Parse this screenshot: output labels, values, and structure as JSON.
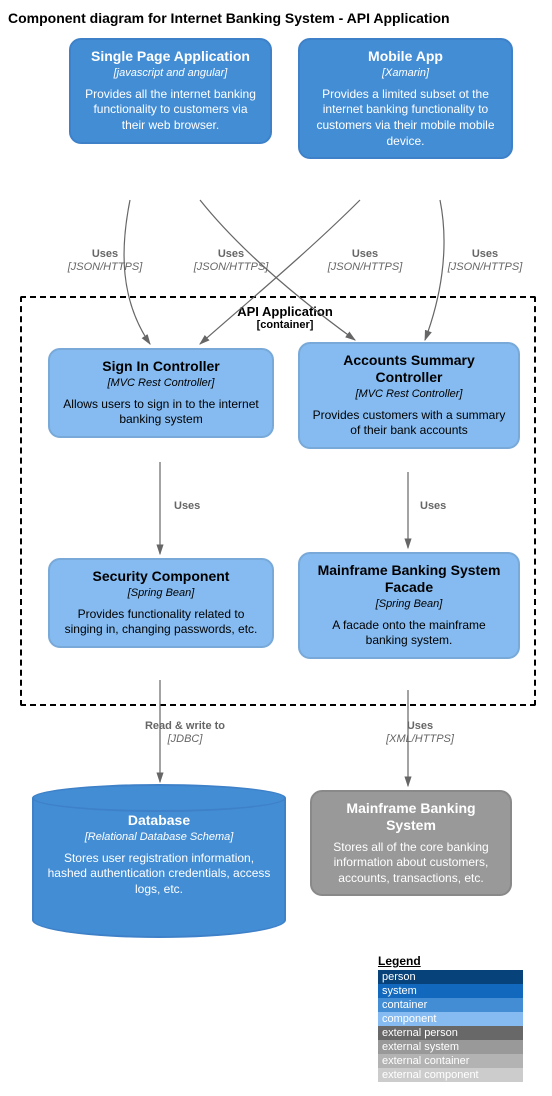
{
  "title": "Component diagram for Internet Banking System - API Application",
  "spa": {
    "title": "Single Page Application",
    "tech": "[javascript and angular]",
    "desc": "Provides all the internet banking functionality to customers via their web browser."
  },
  "mobile": {
    "title": "Mobile App",
    "tech": "[Xamarin]",
    "desc": "Provides a limited subset ot the internet banking functionality to customers via their mobile mobile device."
  },
  "api_container": {
    "title": "API Application",
    "subtitle": "[container]"
  },
  "signin": {
    "title": "Sign In Controller",
    "tech": "[MVC Rest Controller]",
    "desc": "Allows users to sign in to the internet banking system"
  },
  "accounts": {
    "title": "Accounts Summary Controller",
    "tech": "[MVC Rest Controller]",
    "desc": "Provides customers with a summary of their bank accounts"
  },
  "security": {
    "title": "Security Component",
    "tech": "[Spring Bean]",
    "desc": "Provides functionality related to singing in, changing passwords, etc."
  },
  "facade": {
    "title": "Mainframe Banking System Facade",
    "tech": "[Spring Bean]",
    "desc": "A facade onto the mainframe banking system."
  },
  "db": {
    "title": "Database",
    "tech": "[Relational Database Schema]",
    "desc": "Stores user registration information, hashed authentication credentials, access logs, etc."
  },
  "mainframe": {
    "title": "Mainframe Banking System",
    "desc": "Stores all of the core banking information about customers, accounts, transactions, etc."
  },
  "edges": {
    "uses_json_https_1": {
      "label": "Uses",
      "proto": "[JSON/HTTPS]"
    },
    "uses_json_https_2": {
      "label": "Uses",
      "proto": "[JSON/HTTPS]"
    },
    "uses_json_https_3": {
      "label": "Uses",
      "proto": "[JSON/HTTPS]"
    },
    "uses_json_https_4": {
      "label": "Uses",
      "proto": "[JSON/HTTPS]"
    },
    "uses_1": {
      "label": "Uses"
    },
    "uses_2": {
      "label": "Uses"
    },
    "read_write": {
      "label": "Read & write to",
      "proto": "[JDBC]"
    },
    "uses_xml": {
      "label": "Uses",
      "proto": "[XML/HTTPS]"
    }
  },
  "legend": {
    "title": "Legend",
    "items": [
      {
        "label": "person",
        "color": "#08427b"
      },
      {
        "label": "system",
        "color": "#1168bd"
      },
      {
        "label": "container",
        "color": "#438dd5"
      },
      {
        "label": "component",
        "color": "#85bbf0"
      },
      {
        "label": "external person",
        "color": "#686868"
      },
      {
        "label": "external system",
        "color": "#999999"
      },
      {
        "label": "external container",
        "color": "#b3b3b3"
      },
      {
        "label": "external component",
        "color": "#cccccc"
      }
    ]
  }
}
